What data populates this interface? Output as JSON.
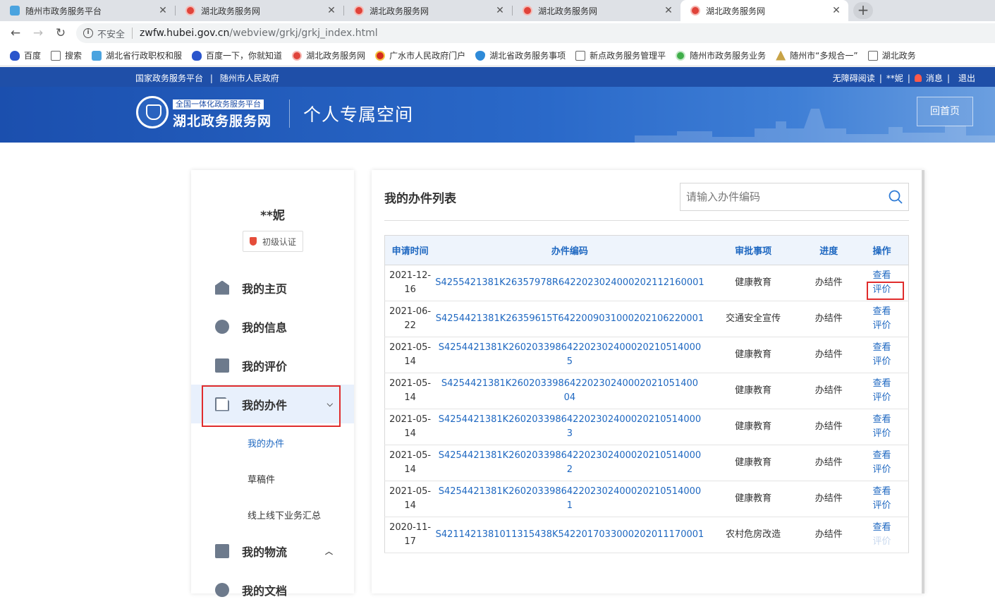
{
  "browser": {
    "tabs": [
      {
        "title": "随州市政务服务平台",
        "icon": "cloud-icon"
      },
      {
        "title": "湖北政务服务网",
        "icon": "seal-icon"
      },
      {
        "title": "湖北政务服务网",
        "icon": "seal-icon"
      },
      {
        "title": "湖北政务服务网",
        "icon": "seal-icon"
      },
      {
        "title": "湖北政务服务网",
        "icon": "seal-icon",
        "active": true
      }
    ],
    "insecure_label": "不安全",
    "url_host": "zwfw.hubei.gov.cn",
    "url_path": "/webview/grkj/grkj_index.html",
    "bookmarks": [
      {
        "label": "百度",
        "icon": "paw"
      },
      {
        "label": "搜索",
        "icon": "page"
      },
      {
        "label": "湖北省行政职权和服",
        "icon": "cloud"
      },
      {
        "label": "百度一下，你就知道",
        "icon": "paw"
      },
      {
        "label": "湖北政务服务网",
        "icon": "seal"
      },
      {
        "label": "广水市人民政府门户",
        "icon": "emblem"
      },
      {
        "label": "湖北省政务服务事项",
        "icon": "shield"
      },
      {
        "label": "新点政务服务管理平",
        "icon": "page"
      },
      {
        "label": "随州市政务服务业务",
        "icon": "green"
      },
      {
        "label": "随州市“多规合一”",
        "icon": "gold"
      },
      {
        "label": "湖北政务",
        "icon": "page"
      }
    ]
  },
  "site": {
    "top_links": [
      "国家政务服务平台",
      "随州市人民政府"
    ],
    "top_separator": "|",
    "accessibility": "无障碍阅读",
    "username": "**妮",
    "messages": "消息",
    "logout": "退出",
    "logo_tag": "全国一体化政务服务平台",
    "logo_name": "湖北政务服务网",
    "banner_title": "个人专属空间",
    "home_button": "回首页"
  },
  "sidebar": {
    "user_name": "**妮",
    "auth_level": "初级认证",
    "menu": [
      {
        "label": "我的主页",
        "icon": "home-icon"
      },
      {
        "label": "我的信息",
        "icon": "chat-icon"
      },
      {
        "label": "我的评价",
        "icon": "edit-icon"
      },
      {
        "label": "我的办件",
        "icon": "document-icon",
        "active": true,
        "expanded": true
      },
      {
        "label": "我的物流",
        "icon": "box-icon"
      },
      {
        "label": "我的文档",
        "icon": "user-icon"
      }
    ],
    "submenu": [
      "我的办件",
      "草稿件",
      "线上线下业务汇总"
    ]
  },
  "main": {
    "title": "我的办件列表",
    "search_placeholder": "请输入办件编码",
    "columns": [
      "申请时间",
      "办件编码",
      "审批事项",
      "进度",
      "操作"
    ],
    "rows": [
      {
        "date": "2021-12-16",
        "code": "S4255421381K26357978R6422023024000202112160001",
        "item": "健康教育",
        "status": "办结件",
        "view": "查看",
        "rate": "评价"
      },
      {
        "date": "2021-06-22",
        "code": "S4254421381K26359615T6422009031000202106220001",
        "item": "交通安全宣传",
        "status": "办结件",
        "view": "查看",
        "rate": "评价"
      },
      {
        "date": "2021-05-14",
        "code": "S4254421381K260203398642202302400020210514000 5",
        "item": "健康教育",
        "status": "办结件",
        "view": "查看",
        "rate": "评价"
      },
      {
        "date": "2021-05-14",
        "code": "S4254421381K26020339864220230240002021051400 04",
        "item": "健康教育",
        "status": "办结件",
        "view": "查看",
        "rate": "评价"
      },
      {
        "date": "2021-05-14",
        "code": "S4254421381K260203398642202302400020210514000 3",
        "item": "健康教育",
        "status": "办结件",
        "view": "查看",
        "rate": "评价"
      },
      {
        "date": "2021-05-14",
        "code": "S4254421381K260203398642202302400020210514000 2",
        "item": "健康教育",
        "status": "办结件",
        "view": "查看",
        "rate": "评价"
      },
      {
        "date": "2021-05-14",
        "code": "S4254421381K260203398642202302400020210514000 1",
        "item": "健康教育",
        "status": "办结件",
        "view": "查看",
        "rate": "评价"
      },
      {
        "date": "2020-11-17",
        "code": "S4211421381011315438K5422017033000202011170001",
        "item": "农村危房改造",
        "status": "办结件",
        "view": "查看",
        "rate": "评价",
        "rate_disabled": true
      }
    ]
  },
  "colors": {
    "brand_blue": "#1f4fa8",
    "link_blue": "#1f68c1",
    "highlight_red": "#e02c2c"
  }
}
